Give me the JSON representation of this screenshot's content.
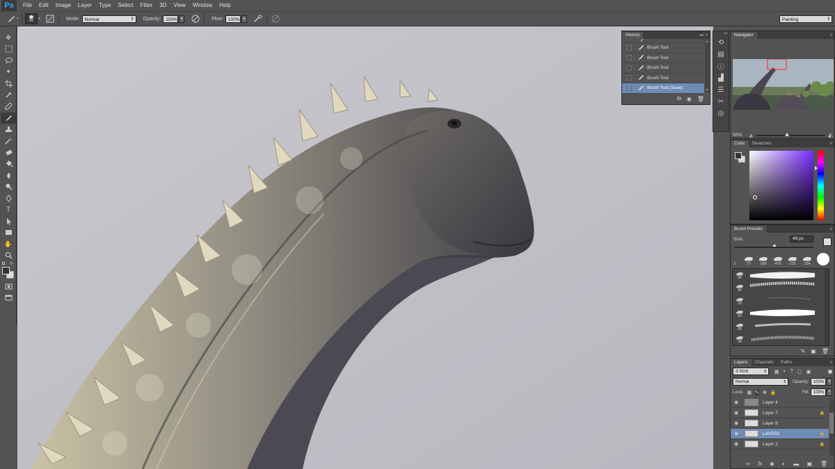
{
  "app": {
    "logo": "Ps"
  },
  "menu": [
    "File",
    "Edit",
    "Image",
    "Layer",
    "Type",
    "Select",
    "Filter",
    "3D",
    "View",
    "Window",
    "Help"
  ],
  "options": {
    "brush_size": "49",
    "mode_label": "Mode:",
    "mode_value": "Normal",
    "opacity_label": "Opacity:",
    "opacity_value": "100%",
    "flow_label": "Flow:",
    "flow_value": "100%",
    "workspace": "Painting"
  },
  "history": {
    "tab": "History",
    "items": [
      {
        "label": "Brush Tool",
        "selected": false
      },
      {
        "label": "Brush Tool",
        "selected": false
      },
      {
        "label": "Brush Tool",
        "selected": false
      },
      {
        "label": "Brush Tool",
        "selected": false
      },
      {
        "label": "Brush Tool (Save)",
        "selected": true
      }
    ]
  },
  "navigator": {
    "tab": "Navigator",
    "zoom": "50%"
  },
  "color": {
    "tabs": [
      "Color",
      "Swatches"
    ],
    "foreground": "#333333",
    "background": "#dcdcdc"
  },
  "brush_presets": {
    "tab": "Brush Presets",
    "size_label": "Size:",
    "size_value": "49 px",
    "recent_sizes": [
      "77",
      "189",
      "475",
      "215",
      "134"
    ],
    "list_sizes": [
      "36",
      "36",
      "33",
      "63",
      "66",
      "39"
    ]
  },
  "layers": {
    "tabs": [
      "Layers",
      "Channels",
      "Paths"
    ],
    "filter": "Kind",
    "blend": "Normal",
    "opacity_label": "Opacity:",
    "opacity_value": "100%",
    "lock_label": "Lock:",
    "fill_label": "Fill:",
    "fill_value": "100%",
    "items": [
      {
        "name": "Layer 4",
        "locked": false,
        "selected": false
      },
      {
        "name": "Layer 7",
        "locked": true,
        "selected": false
      },
      {
        "name": "Layer 8",
        "locked": false,
        "selected": false
      },
      {
        "name": "LAYER1",
        "locked": true,
        "selected": true
      },
      {
        "name": "Layer 2",
        "locked": true,
        "selected": false
      }
    ]
  }
}
